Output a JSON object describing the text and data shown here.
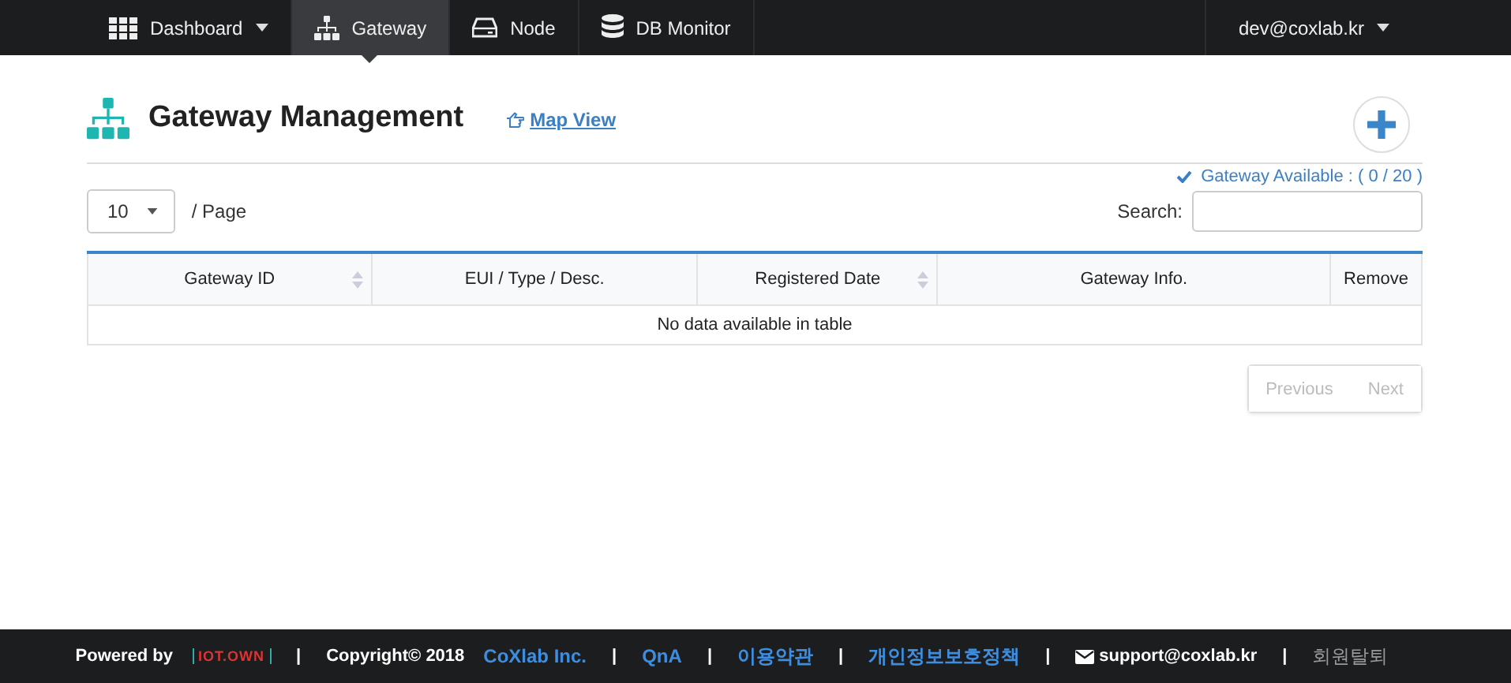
{
  "navbar": {
    "items": [
      {
        "label": "Dashboard",
        "selected": false,
        "dropdown": true
      },
      {
        "label": "Gateway",
        "selected": true,
        "dropdown": false
      },
      {
        "label": "Node",
        "selected": false,
        "dropdown": false
      },
      {
        "label": "DB Monitor",
        "selected": false,
        "dropdown": false
      }
    ],
    "user": {
      "label": "dev@coxlab.kr",
      "dropdown": true
    }
  },
  "header": {
    "title": "Gateway Management",
    "link": "Map View"
  },
  "availability": "Gateway Available : ( 0 / 20 )",
  "page_size": {
    "value": "10",
    "label": "/ Page"
  },
  "search": {
    "label": "Search:"
  },
  "table": {
    "columns": [
      {
        "label": "Gateway ID",
        "sortable": true
      },
      {
        "label": "EUI / Type / Desc.",
        "sortable": false
      },
      {
        "label": "Registered Date",
        "sortable": true
      },
      {
        "label": "Gateway Info.",
        "sortable": false
      },
      {
        "label": "Remove",
        "sortable": false
      }
    ],
    "empty_message": "No data available in table"
  },
  "pagination": [
    {
      "label": "Previous",
      "disabled": true
    },
    {
      "label": "Next",
      "disabled": true
    }
  ],
  "footer": [
    {
      "kind": "text",
      "text": "Powered by"
    },
    {
      "kind": "logo",
      "text": "IOT.OWN"
    },
    {
      "kind": "separator",
      "text": "|"
    },
    {
      "kind": "text",
      "text": "Copyright© 2018"
    },
    {
      "kind": "link",
      "text": "CoXlab Inc."
    },
    {
      "kind": "separator",
      "text": "|"
    },
    {
      "kind": "link",
      "text": "QnA"
    },
    {
      "kind": "separator",
      "text": "|"
    },
    {
      "kind": "link",
      "text": "이용약관"
    },
    {
      "kind": "separator",
      "text": "|"
    },
    {
      "kind": "link",
      "text": "개인정보보호정책"
    },
    {
      "kind": "separator",
      "text": "|"
    },
    {
      "kind": "email",
      "text": "support@coxlab.kr"
    },
    {
      "kind": "separator",
      "text": "|"
    },
    {
      "kind": "muted",
      "text": "회원탈퇴"
    }
  ]
}
